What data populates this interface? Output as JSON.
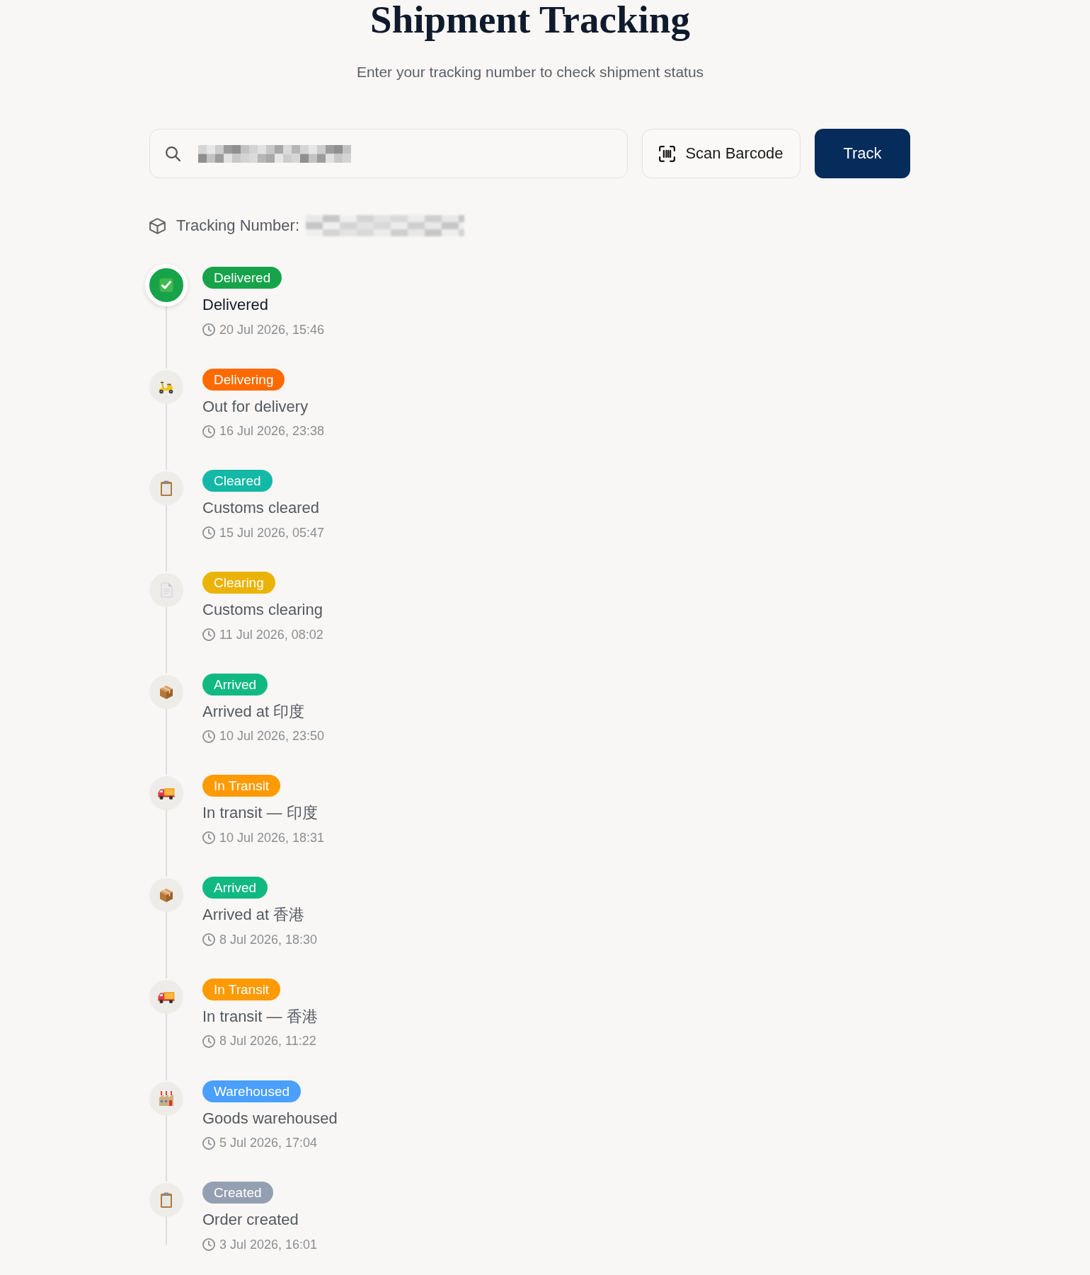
{
  "header": {
    "title": "Shipment Tracking",
    "subtitle": "Enter your tracking number to check shipment status"
  },
  "search": {
    "scan_button": "Scan Barcode",
    "track_button": "Track"
  },
  "tracking": {
    "label": "Tracking Number:"
  },
  "steps": [
    {
      "kind": "delivered",
      "badge": "Delivered",
      "color": "#16a34a",
      "title": "Delivered",
      "time": "20 Jul 2026, 15:46",
      "current": true
    },
    {
      "kind": "delivering",
      "badge": "Delivering",
      "color": "#ff6a00",
      "title": "Out for delivery",
      "time": "16 Jul 2026, 23:38",
      "current": false
    },
    {
      "kind": "cleared",
      "badge": "Cleared",
      "color": "#14b8a6",
      "title": "Customs cleared",
      "time": "15 Jul 2026, 05:47",
      "current": false
    },
    {
      "kind": "clearing",
      "badge": "Clearing",
      "color": "#ebb305",
      "title": "Customs clearing",
      "time": "11 Jul 2026, 08:02",
      "current": false
    },
    {
      "kind": "arrived",
      "badge": "Arrived",
      "color": "#10b981",
      "title": "Arrived at 印度",
      "time": "10 Jul 2026, 23:50",
      "current": false
    },
    {
      "kind": "in_transit",
      "badge": "In Transit",
      "color": "#ff9a00",
      "title": "In transit — 印度",
      "time": "10 Jul 2026, 18:31",
      "current": false
    },
    {
      "kind": "arrived",
      "badge": "Arrived",
      "color": "#10b981",
      "title": "Arrived at 香港",
      "time": "8 Jul 2026, 18:30",
      "current": false
    },
    {
      "kind": "in_transit",
      "badge": "In Transit",
      "color": "#ff9a00",
      "title": "In transit — 香港",
      "time": "8 Jul 2026, 11:22",
      "current": false
    },
    {
      "kind": "warehoused",
      "badge": "Warehoused",
      "color": "#4a9fff",
      "title": "Goods warehoused",
      "time": "5 Jul 2026, 17:04",
      "current": false
    },
    {
      "kind": "created",
      "badge": "Created",
      "color": "#94a0b2",
      "title": "Order created",
      "time": "3 Jul 2026, 16:01",
      "current": false
    }
  ]
}
